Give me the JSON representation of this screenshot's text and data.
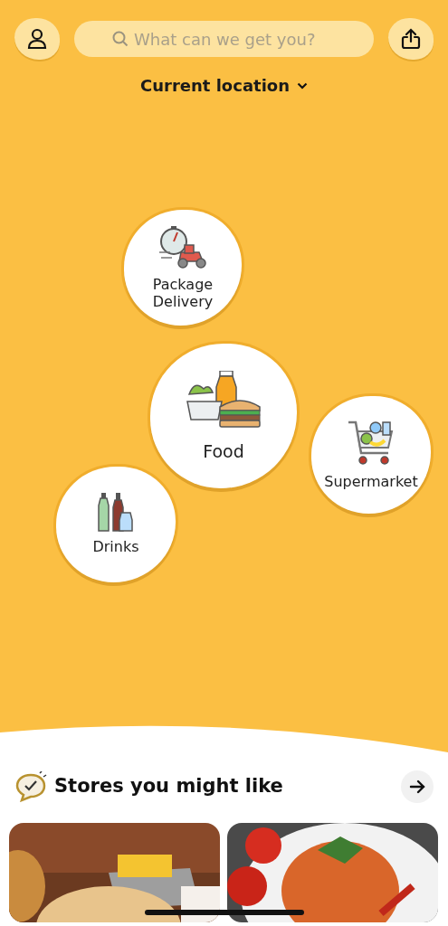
{
  "search": {
    "placeholder": "What can we get you?"
  },
  "location": {
    "label": "Current location"
  },
  "categories": [
    {
      "label": "Package Delivery"
    },
    {
      "label": "Food"
    },
    {
      "label": "Supermarket"
    },
    {
      "label": "Drinks"
    }
  ],
  "stores_section": {
    "title": "Stores you might like"
  }
}
